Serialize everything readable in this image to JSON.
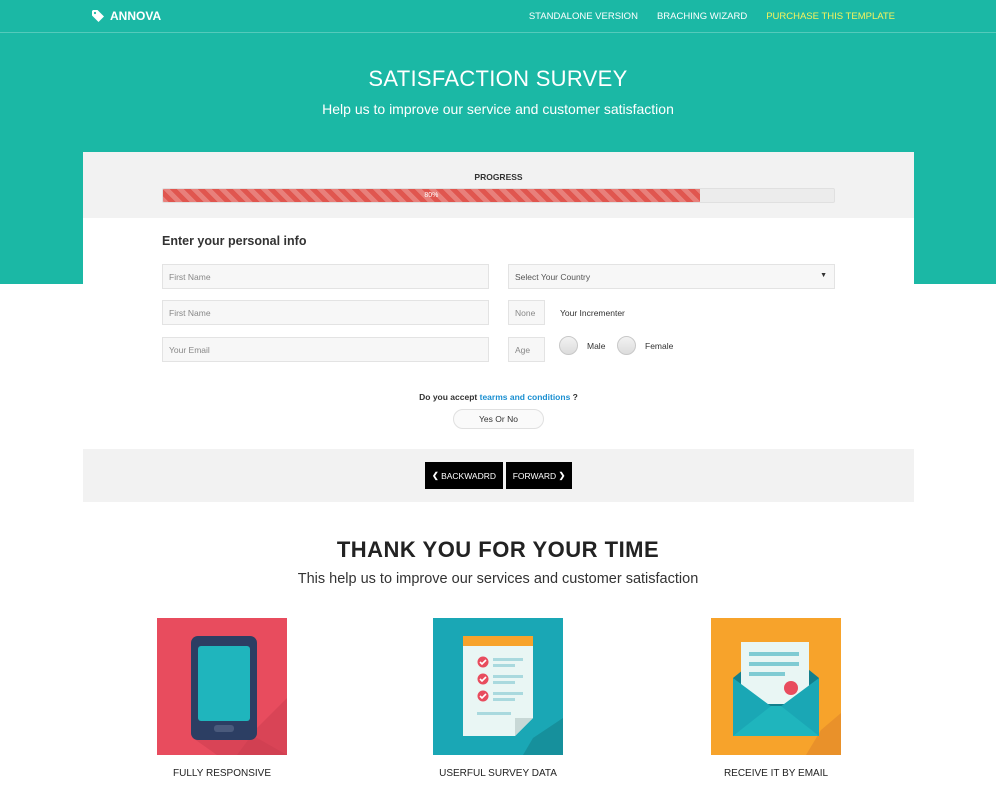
{
  "header": {
    "brand": "ANNOVA",
    "nav": [
      {
        "label": "STANDALONE VERSION"
      },
      {
        "label": "BRACHING WIZARD"
      },
      {
        "label": "PURCHASE THIS TEMPLATE"
      }
    ]
  },
  "hero": {
    "title": "SATISFACTION SURVEY",
    "subtitle": "Help us to improve our service and customer satisfaction"
  },
  "survey": {
    "progress_label": "PROGRESS",
    "progress_value": 0.8,
    "progress_text": "80%",
    "section_title": "Enter your personal info",
    "first_name_placeholder": "First Name",
    "second_name_placeholder": "First Name",
    "email_placeholder": "Your Email",
    "country_selected": "Select Your Country",
    "incrementer_value": "None",
    "incrementer_label": "Your Incrementer",
    "age_placeholder": "Age",
    "gender_male": "Male",
    "gender_female": "Female",
    "terms_prefix": "Do you accept",
    "terms_link": "tearms and conditions",
    "terms_suffix": "?",
    "toggle_label": "Yes Or No",
    "back_label": "BACKWADRD",
    "forward_label": "FORWARD"
  },
  "thanks": {
    "title": "THANK YOU FOR YOUR TIME",
    "subtitle": "This help us to improve our services and customer satisfaction"
  },
  "features": [
    {
      "label": "FULLY RESPONSIVE",
      "icon": "smartphone-icon",
      "color": "#e84c5e"
    },
    {
      "label": "USERFUL SURVEY DATA",
      "icon": "checklist-icon",
      "color": "#1aa7b5"
    },
    {
      "label": "RECEIVE IT BY EMAIL",
      "icon": "envelope-icon",
      "color": "#f7a32b"
    }
  ],
  "colors": {
    "accent": "#1bb8a5",
    "progress": "#e0564f",
    "link": "#1a8fd1",
    "nav_highlight": "#f6f35c"
  }
}
